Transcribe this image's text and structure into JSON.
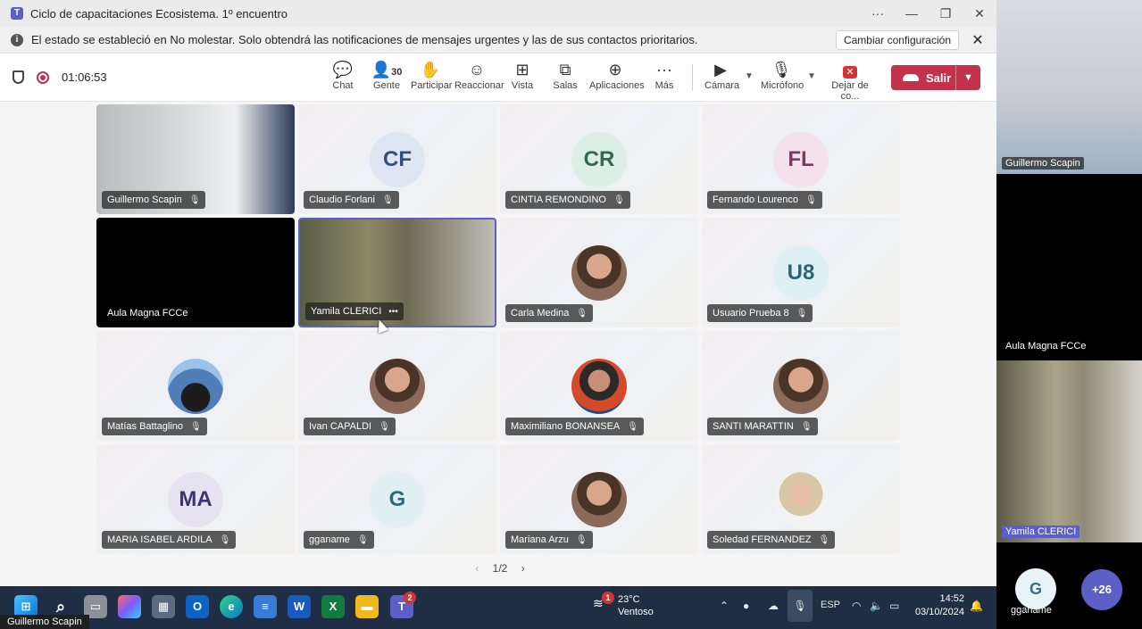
{
  "window": {
    "title": "Ciclo de capacitaciones Ecosistema. 1º encuentro",
    "more": "···",
    "minimize": "—",
    "restore": "❐",
    "close": "✕"
  },
  "notice": {
    "message": "El estado se estableció en No molestar. Solo obtendrá las notificaciones de mensajes urgentes y las de sus contactos prioritarios.",
    "config_button": "Cambiar configuración",
    "dismiss": "✕"
  },
  "toolbar": {
    "timer": "01:06:53",
    "people_count": "30",
    "buttons": {
      "chat": "Chat",
      "people": "Gente",
      "raise": "Participar",
      "react": "Reaccionar",
      "view": "Vista",
      "rooms": "Salas",
      "apps": "Aplicaciones",
      "more": "Más",
      "camera": "Cámara",
      "mic": "Micrófono",
      "stop": "Dejar de co..."
    },
    "leave": "Salir"
  },
  "participants": [
    {
      "name": "Guillermo Scapin",
      "initials": ""
    },
    {
      "name": "Claudio Forlani",
      "initials": "CF"
    },
    {
      "name": "CINTIA REMONDINO",
      "initials": "CR"
    },
    {
      "name": "Fernando Lourenco",
      "initials": "FL"
    },
    {
      "name": "Aula Magna FCCe",
      "initials": ""
    },
    {
      "name": "Yamila CLERICI",
      "initials": ""
    },
    {
      "name": "Carla Medina",
      "initials": ""
    },
    {
      "name": "Usuario Prueba 8",
      "initials": "U8"
    },
    {
      "name": "Matías Battaglino",
      "initials": ""
    },
    {
      "name": "Ivan CAPALDI",
      "initials": ""
    },
    {
      "name": "Maximiliano BONANSEA",
      "initials": ""
    },
    {
      "name": "SANTI MARATTIN",
      "initials": ""
    },
    {
      "name": "MARIA ISABEL ARDILA",
      "initials": "MA"
    },
    {
      "name": "gganame",
      "initials": "G"
    },
    {
      "name": "Mariana Arzu",
      "initials": ""
    },
    {
      "name": "Soledad FERNANDEZ",
      "initials": ""
    }
  ],
  "speaker_more": "•••",
  "pager": {
    "label": "1/2",
    "prev": "‹",
    "next": "›"
  },
  "taskbar": {
    "teams_badge": "2",
    "weather_badge": "1",
    "temperature": "23°C",
    "condition": "Ventoso",
    "language": "ESP",
    "time": "14:52",
    "date": "03/10/2024"
  },
  "bottom_caption": "Guillermo Scapin",
  "side_panel": {
    "top_name": "Guillermo Scapin",
    "middle_name": "Aula Magna FCCe",
    "bottom_name": "Yamila CLERICI",
    "avatar_initial": "G",
    "avatar_name": "gganame",
    "overflow": "+26"
  },
  "colors": {
    "brand": "#5b5fc7",
    "leave": "#c4314b",
    "taskbar": "#1f2e45"
  }
}
